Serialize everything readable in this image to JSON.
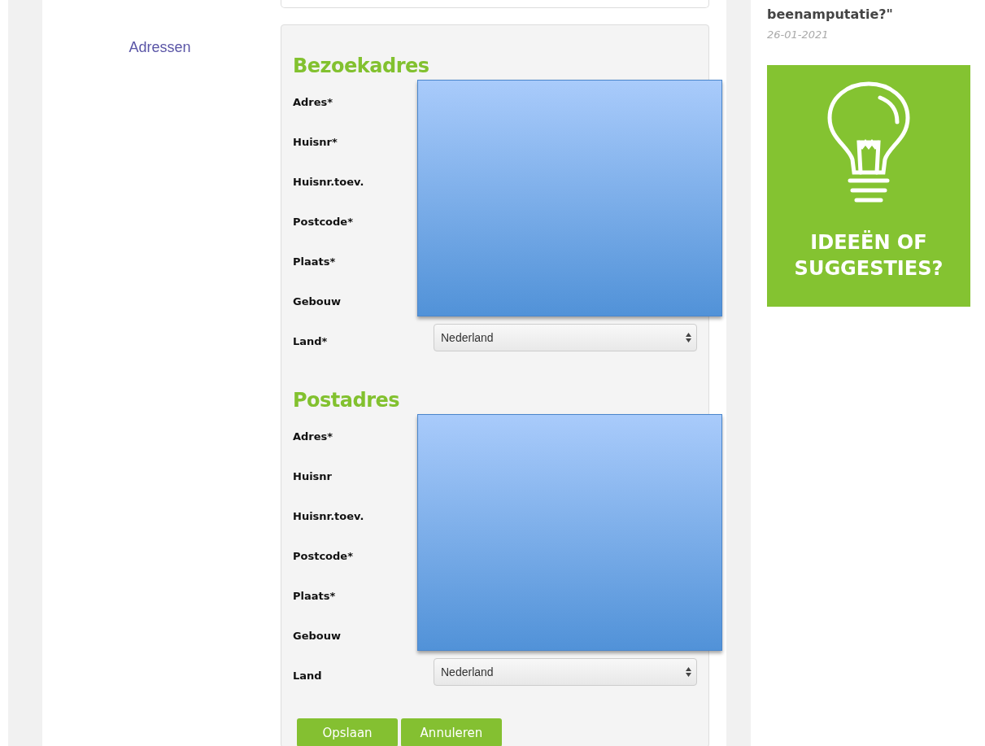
{
  "side_nav": {
    "items": [
      {
        "label": "Adressen"
      }
    ]
  },
  "sections": [
    {
      "title": "Bezoekadres",
      "fields": [
        {
          "label": "Adres*"
        },
        {
          "label": "Huisnr*"
        },
        {
          "label": "Huisnr.toev."
        },
        {
          "label": "Postcode*"
        },
        {
          "label": "Plaats*"
        },
        {
          "label": "Gebouw"
        }
      ],
      "country": {
        "label": "Land*",
        "value": "Nederland"
      }
    },
    {
      "title": "Postadres",
      "fields": [
        {
          "label": "Adres*"
        },
        {
          "label": "Huisnr"
        },
        {
          "label": "Huisnr.toev."
        },
        {
          "label": "Postcode*"
        },
        {
          "label": "Plaats*"
        },
        {
          "label": "Gebouw"
        }
      ],
      "country": {
        "label": "Land",
        "value": "Nederland"
      }
    }
  ],
  "buttons": [
    "Opslaan",
    "Annuleren"
  ],
  "sidebar": {
    "article_title": "beenamputatie?\"",
    "article_date": "26-01-2021",
    "banner": {
      "line_1": "IDEEËN OF",
      "line_2": "SUGGESTIES?"
    }
  }
}
